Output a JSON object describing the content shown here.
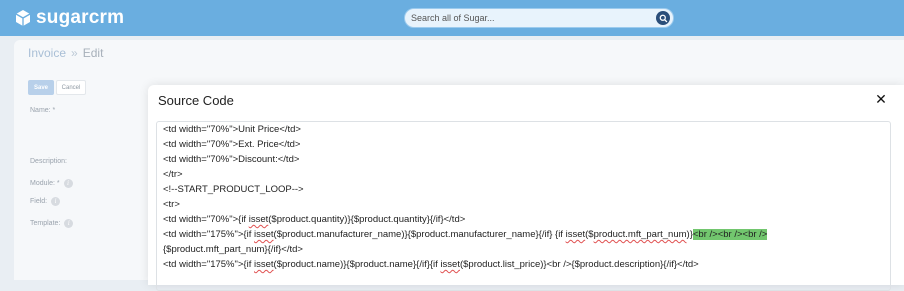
{
  "app": {
    "logo_text": "sugarcrm",
    "search_placeholder": "Search all of Sugar..."
  },
  "breadcrumb": {
    "module": "Invoice",
    "separator": "»",
    "action": "Edit"
  },
  "toolbar": {
    "save_label": "Save",
    "cancel_label": "Cancel"
  },
  "fields": {
    "name": "Name: *",
    "description": "Description:",
    "module": "Module: *",
    "field": "Field:",
    "template": "Template:"
  },
  "modal": {
    "title": "Source Code",
    "close_glyph": "✕",
    "code_lines": {
      "l1": "<td width=\"70%\">Unit Price</td>",
      "l2": "<td width=\"70%\">Ext. Price</td>",
      "l3": "<td width=\"70%\">Discount:</td>",
      "l4": "</tr>",
      "l5": "<!--START_PRODUCT_LOOP-->",
      "l6": "<tr>",
      "l7a": "<td width=\"70%\">{if ",
      "l7b": "isset",
      "l7c": "($product.quantity)}{$product.quantity}{/if}</td>",
      "l8a": "<td width=\"175%\">{if ",
      "l8b": "isset",
      "l8c": "($product.manufacturer_name)}{$product.manufacturer_name}{/if} {if ",
      "l8d": "isset",
      "l8e": "($",
      "l8f": "product.mft_part_num",
      "l8g": ")}",
      "l8h": "<br /><br /><br />",
      "l9": "{$product.mft_part_num}{/if}</td>",
      "l10a": "<td width=\"175%\">{if ",
      "l10b": "isset",
      "l10c": "($product.name)}{$product.name}{/if}{if ",
      "l10d": "isset",
      "l10e": "($product.list_price)}<br />{$product.description}{/if}</td>"
    }
  },
  "colors": {
    "topbar": "#6aaee0",
    "highlight": "#72c66e"
  },
  "icons": {
    "logo": "sugar-cube-icon",
    "search": "search-icon",
    "info": "info-icon",
    "close": "close-icon"
  }
}
